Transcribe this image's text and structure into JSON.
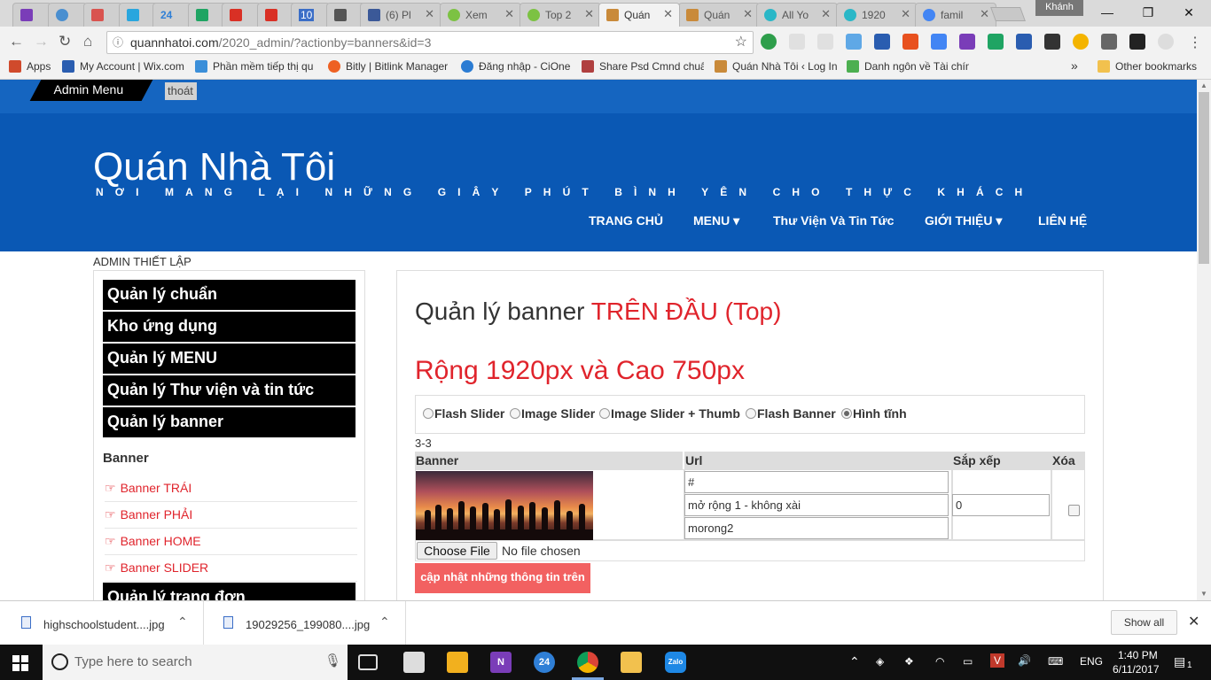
{
  "browser": {
    "tabs": [
      {
        "label": "",
        "color": "#7a3db8"
      },
      {
        "label": "",
        "color": "#4a8fd0"
      },
      {
        "label": "",
        "color": "#d9534f"
      },
      {
        "label": "",
        "color": "#29a6de"
      },
      {
        "label": "24",
        "color": "#2f7fd6"
      },
      {
        "label": "",
        "color": "#1fa463"
      },
      {
        "label": "",
        "color": "#d93025"
      },
      {
        "label": "",
        "color": "#d93025"
      },
      {
        "label": "10",
        "color": "#3b6ec7"
      },
      {
        "label": "",
        "color": "#555555"
      },
      {
        "label": "(6) Pl",
        "color": "#3b5998"
      },
      {
        "label": "Xem",
        "color": "#7cc243"
      },
      {
        "label": "Top 2",
        "color": "#7cc243"
      },
      {
        "label": "Quán",
        "color": "#c98a3a"
      },
      {
        "label": "Quán",
        "color": "#c98a3a"
      },
      {
        "label": "All Yo",
        "color": "#2ab7c7"
      },
      {
        "label": "1920",
        "color": "#2ab7c7"
      },
      {
        "label": "famil",
        "color": "#4285f4"
      }
    ],
    "profile_name": "Khánh",
    "url_host": "quannhatoi.com",
    "url_path": "/2020_admin/?actionby=banners&id=3",
    "bookmarks": [
      {
        "label": "Apps",
        "color": "#d04a2c"
      },
      {
        "label": "My Account | Wix.com",
        "color": "#2a5db0"
      },
      {
        "label": "Phần mềm tiếp thị qu",
        "color": "#3b8fd9"
      },
      {
        "label": "Bitly | Bitlink Manager",
        "color": "#ee6123"
      },
      {
        "label": "Đăng nhập - CiOne",
        "color": "#2b7cd3"
      },
      {
        "label": "Share Psd Cmnd chuẩ",
        "color": "#b04040"
      },
      {
        "label": "Quán Nhà Tôi ‹ Log In",
        "color": "#c98a3a"
      },
      {
        "label": "Danh ngôn về Tài chín",
        "color": "#4caf50"
      }
    ],
    "more_bookmarks": "»",
    "other_bookmarks": "Other bookmarks"
  },
  "site": {
    "admin_menu": "Admin Menu",
    "logout": "thoát",
    "title": "Quán Nhà Tôi",
    "tagline": "NƠI MANG LẠI NHỮNG GIÂY PHÚT BÌNH YÊN CHO THỰC KHÁCH",
    "nav": [
      "TRANG CHỦ",
      "MENU ▾",
      "Thư Viện Và Tin Tức",
      "GIỚI THIỆU ▾",
      "LIÊN HỆ"
    ],
    "admin_title": "ADMIN THIẾT LẬP"
  },
  "sidebar": {
    "menus": [
      "Quản lý chuẩn",
      "Kho ứng dụng",
      "Quản lý MENU",
      "Quản lý Thư viện và tin tức",
      "Quản lý banner"
    ],
    "section": "Banner",
    "links": [
      "Banner TRÁI",
      "Banner PHẢI",
      "Banner HOME",
      "Banner SLIDER"
    ],
    "next_menu": "Quản lý trang đơn"
  },
  "content": {
    "heading_prefix": "Quản lý banner ",
    "heading_highlight": "TRÊN ĐẦU (Top)",
    "size_note": "Rộng 1920px và Cao 750px",
    "radio_options": [
      "Flash Slider",
      "Image Slider",
      "Image Slider + Thumb",
      "Flash Banner",
      "Hình tĩnh"
    ],
    "radio_selected": "Hình tĩnh",
    "counter": "3-3",
    "table_headers": [
      "Banner",
      "Url",
      "Sắp xếp",
      "Xóa"
    ],
    "row": {
      "url": "#",
      "desc": "mở rộng 1 - không xài",
      "name": "morong2",
      "order": "0",
      "delete_checked": false
    },
    "choose_file": "Choose File",
    "no_file": "No file chosen",
    "update_button": "cập nhật những thông tin trên"
  },
  "downloads": {
    "items": [
      "highschoolstudent....jpg",
      "19029256_199080....jpg"
    ],
    "show_all": "Show all"
  },
  "taskbar": {
    "search_placeholder": "Type here to search",
    "language": "ENG",
    "time": "1:40 PM",
    "date": "6/11/2017",
    "notification_count": "1",
    "badge_24": "24"
  }
}
